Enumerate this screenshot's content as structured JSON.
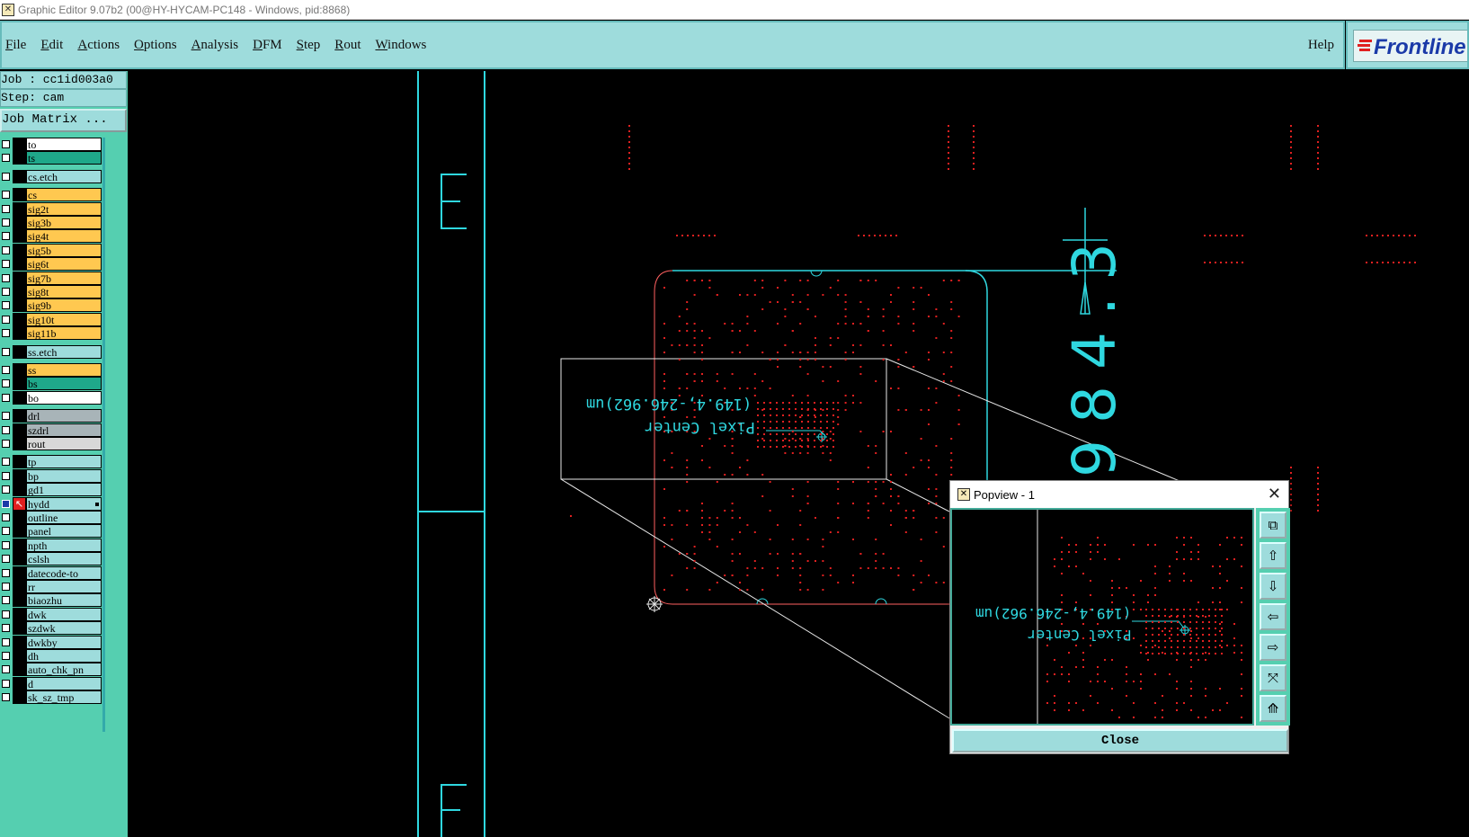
{
  "window": {
    "title": "Graphic Editor 9.07b2 (00@HY-HYCAM-PC148 - Windows, pid:8868)"
  },
  "menu": {
    "items": [
      "File",
      "Edit",
      "Actions",
      "Options",
      "Analysis",
      "DFM",
      "Step",
      "Rout",
      "Windows"
    ],
    "help": "Help"
  },
  "logo": {
    "text": "Frontline"
  },
  "info": {
    "job": "Job : cc1id003a0",
    "step": "Step: cam",
    "matrix_button": "Job Matrix ..."
  },
  "layers": [
    {
      "name": "to",
      "color": "#ffffff"
    },
    {
      "name": "ts",
      "color": "#1fa88a"
    },
    {
      "name": "cs.etch",
      "color": "#9edcdc"
    },
    {
      "name": "cs",
      "color": "#ffc850"
    },
    {
      "name": "sig2t",
      "color": "#ffc850"
    },
    {
      "name": "sig3b",
      "color": "#ffc850"
    },
    {
      "name": "sig4t",
      "color": "#ffc850"
    },
    {
      "name": "sig5b",
      "color": "#ffc850"
    },
    {
      "name": "sig6t",
      "color": "#ffc850"
    },
    {
      "name": "sig7b",
      "color": "#ffc850"
    },
    {
      "name": "sig8t",
      "color": "#ffc850"
    },
    {
      "name": "sig9b",
      "color": "#ffc850"
    },
    {
      "name": "sig10t",
      "color": "#ffc850"
    },
    {
      "name": "sig11b",
      "color": "#ffc850"
    },
    {
      "name": "ss.etch",
      "color": "#9edcdc"
    },
    {
      "name": "ss",
      "color": "#ffc850"
    },
    {
      "name": "bs",
      "color": "#1fa88a"
    },
    {
      "name": "bo",
      "color": "#ffffff"
    },
    {
      "name": "drl",
      "color": "#a8b4b8"
    },
    {
      "name": "szdrl",
      "color": "#a8b4b8"
    },
    {
      "name": "rout",
      "color": "#d8d8d8"
    },
    {
      "name": "tp",
      "color": "#9edcdc"
    },
    {
      "name": "bp",
      "color": "#9edcdc"
    },
    {
      "name": "gd1",
      "color": "#9edcdc"
    },
    {
      "name": "hydd",
      "color": "#9edcdc",
      "selected": true
    },
    {
      "name": "outline",
      "color": "#9edcdc"
    },
    {
      "name": "panel",
      "color": "#9edcdc"
    },
    {
      "name": "npth",
      "color": "#9edcdc"
    },
    {
      "name": "cslsh",
      "color": "#9edcdc"
    },
    {
      "name": "datecode-to",
      "color": "#9edcdc"
    },
    {
      "name": "rr",
      "color": "#9edcdc"
    },
    {
      "name": "biaozhu",
      "color": "#9edcdc"
    },
    {
      "name": "dwk",
      "color": "#9edcdc"
    },
    {
      "name": "szdwk",
      "color": "#9edcdc"
    },
    {
      "name": "dwkby",
      "color": "#9edcdc"
    },
    {
      "name": "dh",
      "color": "#9edcdc"
    },
    {
      "name": "auto_chk_pn",
      "color": "#9edcdc"
    },
    {
      "name": "d",
      "color": "#9edcdc"
    },
    {
      "name": "sk_sz_tmp",
      "color": "#9edcdc"
    }
  ],
  "canvas": {
    "marker_text_1": "Pixel Center",
    "marker_text_2": "(149.4,-246.962)um",
    "dimension_text": "984.3",
    "letter_top": "E",
    "letter_bottom": "F"
  },
  "popview": {
    "title": "Popview - 1",
    "marker_text_1": "Pixel Center",
    "marker_text_2": "(149.4,-246.962)um",
    "close_button": "Close",
    "tools": [
      "zoom-window-icon",
      "pan-up-icon",
      "pan-down-icon",
      "pan-left-icon",
      "pan-right-icon",
      "zoom-fit-icon",
      "zoom-home-icon"
    ]
  },
  "colors": {
    "menu_bg": "#9edcdc",
    "panel_bg": "#55cfb0",
    "feature_red": "#e02020",
    "outline_cyan": "#2fd8e0"
  }
}
